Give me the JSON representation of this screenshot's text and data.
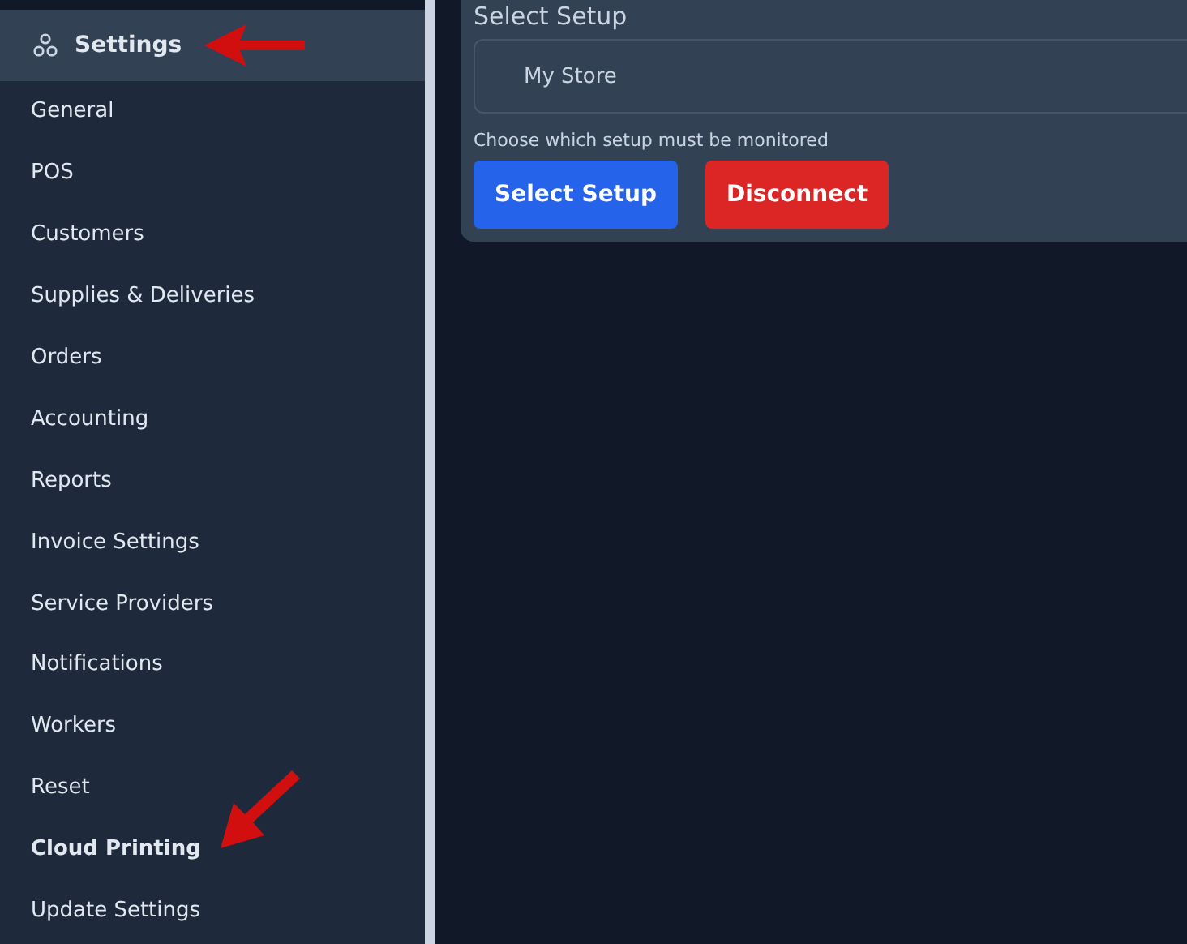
{
  "sidebar": {
    "header": "Settings",
    "items": [
      {
        "label": "General",
        "selected": false
      },
      {
        "label": "POS",
        "selected": false
      },
      {
        "label": "Customers",
        "selected": false
      },
      {
        "label": "Supplies & Deliveries",
        "selected": false
      },
      {
        "label": "Orders",
        "selected": false
      },
      {
        "label": "Accounting",
        "selected": false
      },
      {
        "label": "Reports",
        "selected": false
      },
      {
        "label": "Invoice Settings",
        "selected": false
      },
      {
        "label": "Service Providers",
        "selected": false
      },
      {
        "label": "Notifications",
        "selected": false
      },
      {
        "label": "Workers",
        "selected": false
      },
      {
        "label": "Reset",
        "selected": false
      },
      {
        "label": "Cloud Printing",
        "selected": true
      },
      {
        "label": "Update Settings",
        "selected": false
      }
    ]
  },
  "setup": {
    "title": "Select Setup",
    "value": "My Store",
    "hint": "Choose which setup must be monitored",
    "buttons": [
      {
        "label": "Select Setup",
        "kind": "primary"
      },
      {
        "label": "Disconnect",
        "kind": "danger"
      }
    ]
  }
}
